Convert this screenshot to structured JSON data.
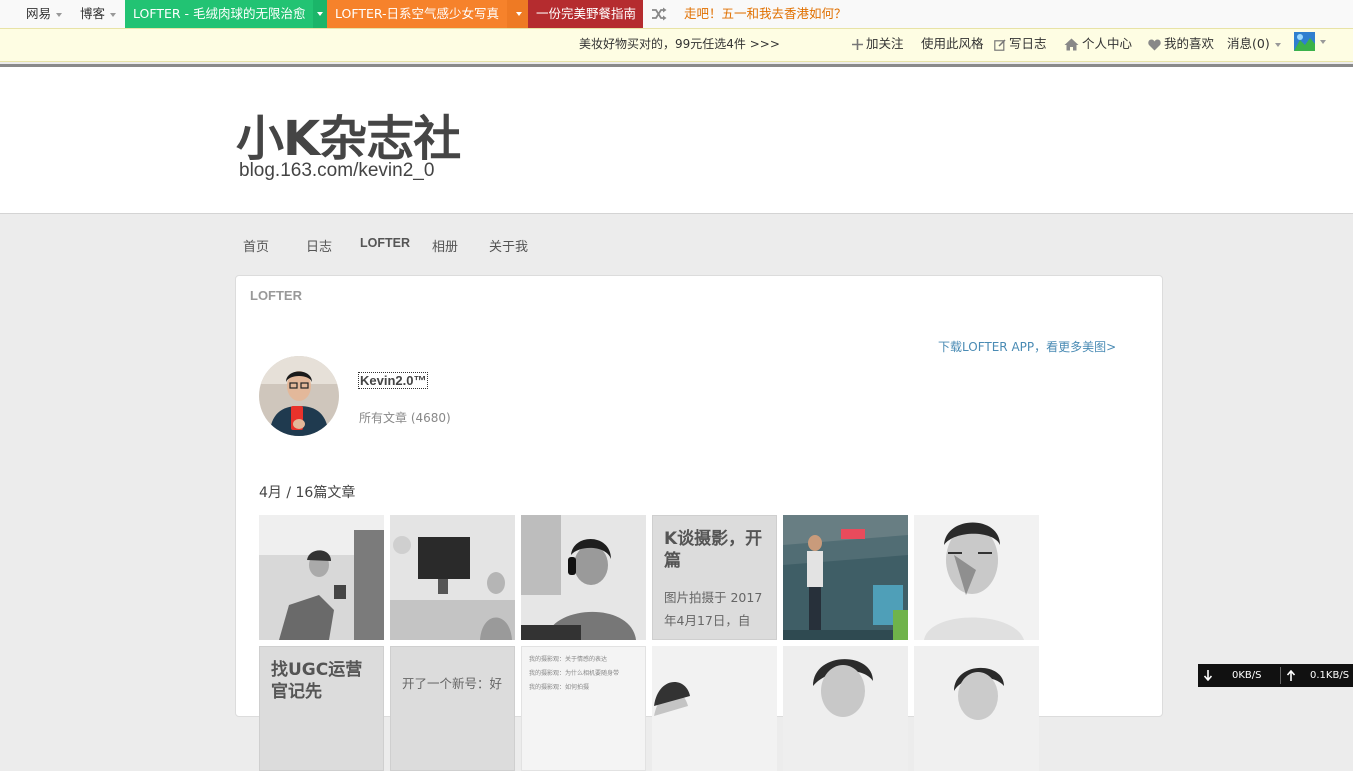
{
  "topbar": {
    "items": [
      {
        "label": "网易"
      },
      {
        "label": "博客"
      },
      {
        "label": "LOFTER - 毛绒肉球的无限治愈",
        "bg": "#22c373"
      },
      {
        "label": "LOFTER-日系空气感少女写真",
        "bg": "#f6822b"
      },
      {
        "label": "一份完美野餐指南",
        "bg": "#b52c2f"
      }
    ],
    "promo_link": "走吧！五一和我去香港如何？",
    "promo_color": "#e07000"
  },
  "notice": {
    "text": "美妆好物买对的，99元任选4件 >>>",
    "actions": [
      {
        "label": "加关注",
        "icon": "plus-icon"
      },
      {
        "label": "使用此风格"
      },
      {
        "label": "写日志",
        "icon": "edit-icon"
      },
      {
        "label": "个人中心",
        "icon": "home-icon"
      },
      {
        "label": "我的喜欢",
        "icon": "heart-icon"
      },
      {
        "label": "消息(0)"
      }
    ]
  },
  "header": {
    "title": "小K杂志社",
    "url": "blog.163.com/kevin2_0"
  },
  "nav": {
    "items": [
      "首页",
      "日志",
      "LOFTER",
      "相册",
      "关于我"
    ],
    "active": "LOFTER"
  },
  "panel": {
    "title": "LOFTER",
    "download_link": "下载LOFTER APP，看更多美图>",
    "user_name": "Kevin2.0™",
    "all_posts": "所有文章 (4680)",
    "month_heading": "4月 / 16篇文章",
    "text_posts": [
      {
        "title": "K谈摄影，开篇",
        "body": "图片拍摄于 2017年4月17日，自"
      },
      {
        "title": "找UGC运营官记先",
        "body": ""
      },
      {
        "title": "",
        "body": "开了一个新号：好"
      }
    ],
    "list_post_lines": [
      "我的摄影观：关于情感的表达",
      "我的摄影观：为什么相机要随身带",
      "我的摄影观：如何拍摄"
    ]
  },
  "speed": {
    "down": "0KB/S",
    "up": "0.1KB/S"
  }
}
